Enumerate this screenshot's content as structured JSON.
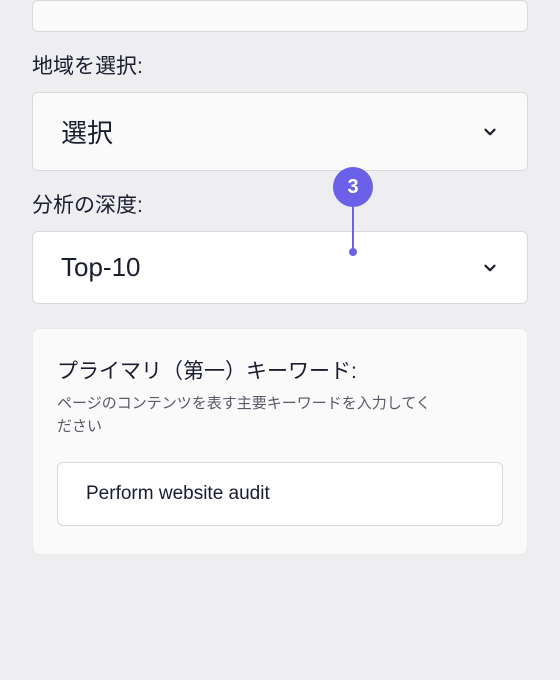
{
  "top_input": {
    "value": ""
  },
  "region": {
    "label": "地域を選択:",
    "value": "選択"
  },
  "depth": {
    "label": "分析の深度:",
    "value": "Top-10"
  },
  "badge": {
    "number": "3"
  },
  "keyword": {
    "title": "プライマリ（第一）キーワード:",
    "description": "ページのコンテンツを表す主要キーワードを入力してください",
    "value": "Perform website audit"
  }
}
